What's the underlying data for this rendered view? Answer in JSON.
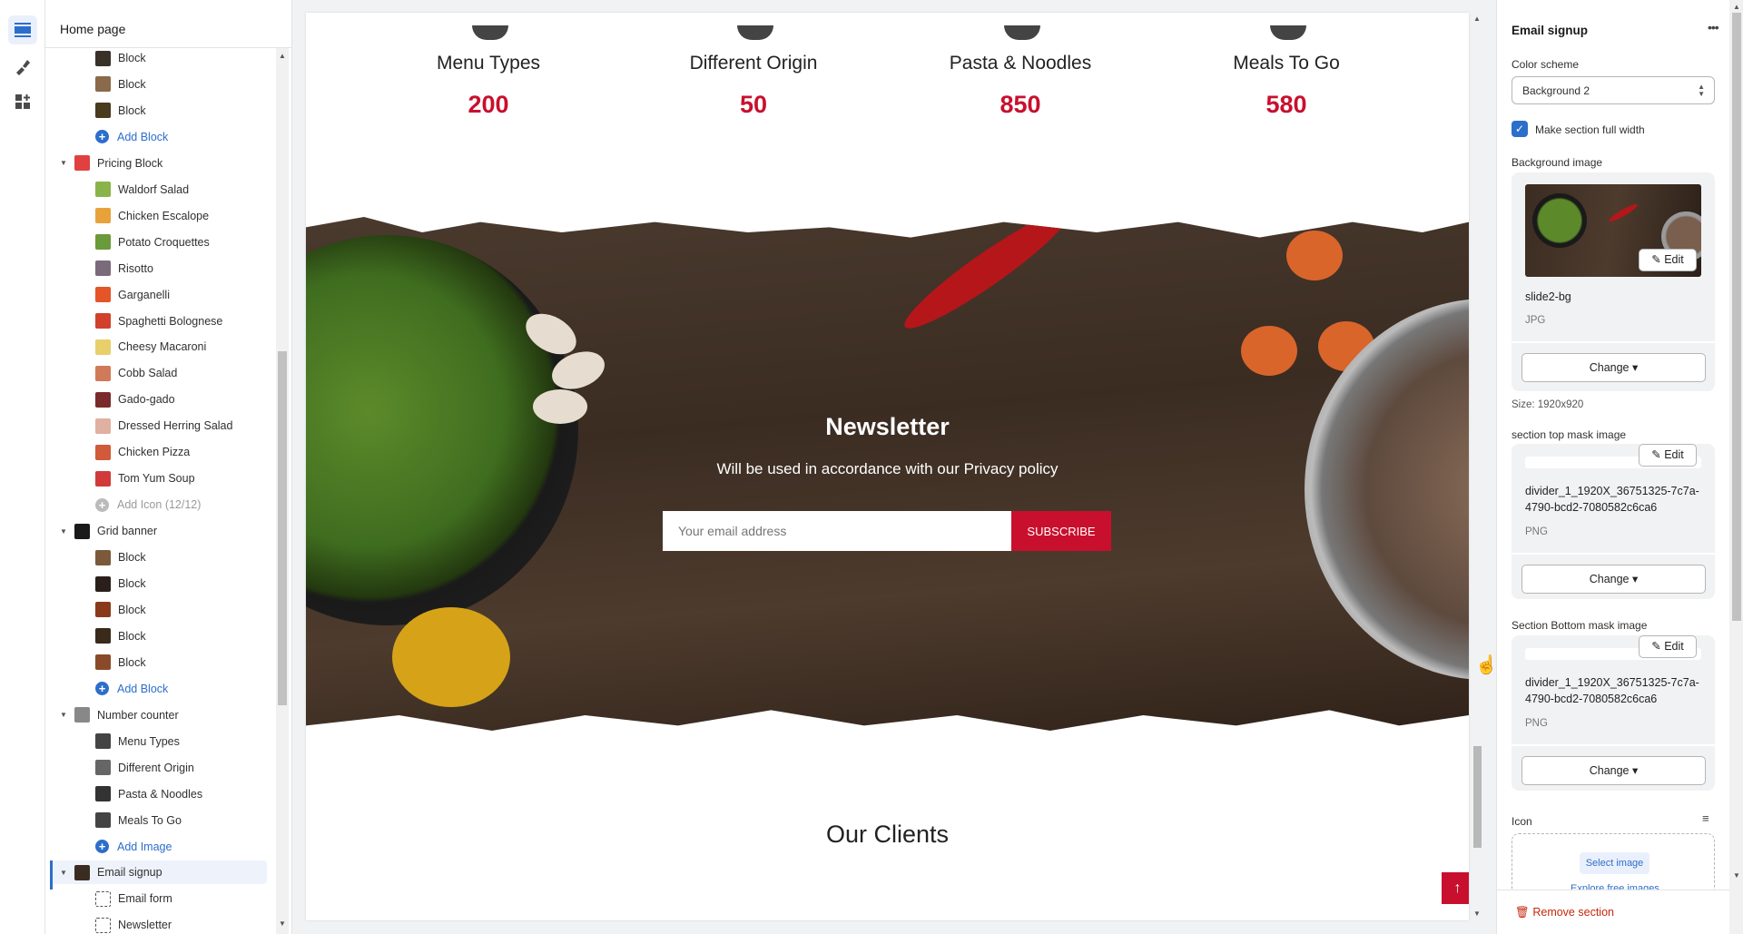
{
  "tree": {
    "title": "Home page",
    "rows": [
      {
        "type": "child",
        "label": "Block",
        "color": "#3a3128"
      },
      {
        "type": "child",
        "label": "Block",
        "color": "#8a6a4a"
      },
      {
        "type": "child",
        "label": "Block",
        "color": "#4a3a1e"
      },
      {
        "type": "add",
        "label": "Add Block"
      },
      {
        "type": "sec",
        "label": "Pricing Block",
        "color": "#e04040"
      },
      {
        "type": "child",
        "label": "Waldorf Salad",
        "color": "#8ab34a"
      },
      {
        "type": "child",
        "label": "Chicken Escalope",
        "color": "#e8a23a"
      },
      {
        "type": "child",
        "label": "Potato Croquettes",
        "color": "#6a9a3a"
      },
      {
        "type": "child",
        "label": "Risotto",
        "color": "#7a6a7a"
      },
      {
        "type": "child",
        "label": "Garganelli",
        "color": "#e4552a"
      },
      {
        "type": "child",
        "label": "Spaghetti Bolognese",
        "color": "#d0402a"
      },
      {
        "type": "child",
        "label": "Cheesy Macaroni",
        "color": "#e8cf6a"
      },
      {
        "type": "child",
        "label": "Cobb Salad",
        "color": "#d07a5a"
      },
      {
        "type": "child",
        "label": "Gado-gado",
        "color": "#7a2a2a"
      },
      {
        "type": "child",
        "label": "Dressed Herring Salad",
        "color": "#e0b0a0"
      },
      {
        "type": "child",
        "label": "Chicken Pizza",
        "color": "#d05a3a"
      },
      {
        "type": "child",
        "label": "Tom Yum Soup",
        "color": "#d03a3a"
      },
      {
        "type": "add-dis",
        "label": "Add Icon (12/12)"
      },
      {
        "type": "sec",
        "label": "Grid banner",
        "color": "#1a1a1a"
      },
      {
        "type": "child",
        "label": "Block",
        "color": "#7a5a3a"
      },
      {
        "type": "child",
        "label": "Block",
        "color": "#2a1f1a"
      },
      {
        "type": "child",
        "label": "Block",
        "color": "#8a3a1a"
      },
      {
        "type": "child",
        "label": "Block",
        "color": "#3a2a1a"
      },
      {
        "type": "child",
        "label": "Block",
        "color": "#8a4a2a"
      },
      {
        "type": "add",
        "label": "Add Block"
      },
      {
        "type": "sec",
        "label": "Number counter",
        "color": "#888"
      },
      {
        "type": "child",
        "label": "Menu Types",
        "color": "#444"
      },
      {
        "type": "child",
        "label": "Different Origin",
        "color": "#666"
      },
      {
        "type": "child",
        "label": "Pasta & Noodles",
        "color": "#333"
      },
      {
        "type": "child",
        "label": "Meals To Go",
        "color": "#444"
      },
      {
        "type": "add",
        "label": "Add Image"
      },
      {
        "type": "sec-selected",
        "label": "Email signup",
        "color": "#3b2c22"
      },
      {
        "type": "child",
        "label": "Email form",
        "color": "#fff"
      },
      {
        "type": "child",
        "label": "Newsletter",
        "color": "#fff"
      }
    ]
  },
  "preview": {
    "stats": [
      {
        "label": "Menu Types",
        "value": "200"
      },
      {
        "label": "Different Origin",
        "value": "50"
      },
      {
        "label": "Pasta & Noodles",
        "value": "850"
      },
      {
        "label": "Meals To Go",
        "value": "580"
      }
    ],
    "newsletter": {
      "title": "Newsletter",
      "subtitle": "Will be used in accordance with our Privacy policy",
      "placeholder": "Your email address",
      "button": "SUBSCRIBE"
    },
    "clients_title": "Our Clients",
    "back_to_top": "↑",
    "accent": "#c8102e"
  },
  "panel": {
    "title": "Email signup",
    "more": "•••",
    "color_scheme_label": "Color scheme",
    "color_scheme_value": "Background 2",
    "full_width_label": "Make section full width",
    "full_width_checked": true,
    "bg_label": "Background image",
    "bg_name": "slide2-bg",
    "bg_type": "JPG",
    "size": "Size: 1920x920",
    "top_mask_label": "section top mask image",
    "top_mask_name": "divider_1_1920X_36751325-7c7a-4790-bcd2-7080582c6ca6",
    "top_mask_type": "PNG",
    "bottom_mask_label": "Section Bottom mask image",
    "bottom_mask_name": "divider_1_1920X_36751325-7c7a-4790-bcd2-7080582c6ca6",
    "bottom_mask_type": "PNG",
    "change": "Change",
    "edit": "Edit",
    "icon_label": "Icon",
    "select_image": "Select image",
    "explore": "Explore free images",
    "remove": "Remove section"
  }
}
